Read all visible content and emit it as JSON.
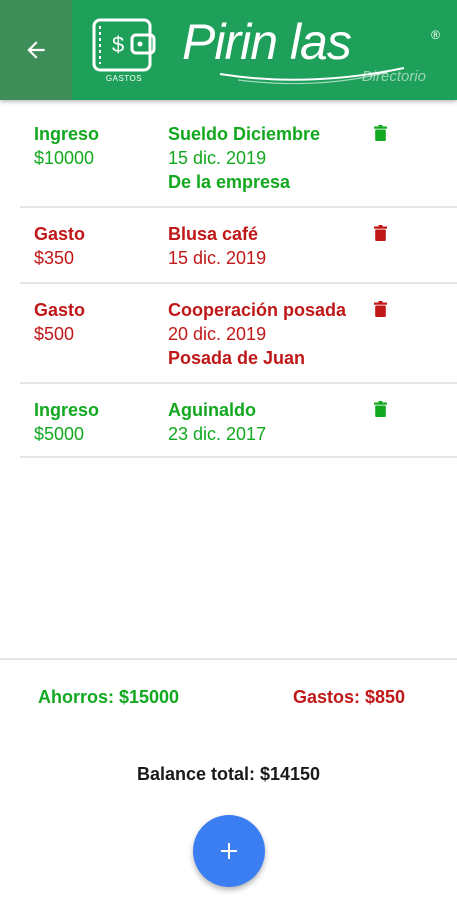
{
  "header": {
    "back_icon": "arrow-left-icon",
    "wallet_caption": "GASTOS",
    "brand": "Pirin las",
    "brand_sub": "Directorio",
    "brand_reg": "®",
    "colors": {
      "bar": "#1ea05a",
      "back_bg": "#3f8e5a"
    }
  },
  "entries": [
    {
      "type": "Ingreso",
      "amount": "$10000",
      "title": "Sueldo Diciembre",
      "date": "15 dic. 2019",
      "note": "De la empresa",
      "kind": "income"
    },
    {
      "type": "Gasto",
      "amount": "$350",
      "title": "Blusa café",
      "date": "15 dic. 2019",
      "note": "",
      "kind": "expense"
    },
    {
      "type": "Gasto",
      "amount": "$500",
      "title": "Cooperación posada",
      "date": "20 dic. 2019",
      "note": "Posada de Juan",
      "kind": "expense"
    },
    {
      "type": "Ingreso",
      "amount": "$5000",
      "title": "Aguinaldo",
      "date": "23 dic. 2017",
      "note": "",
      "kind": "income"
    }
  ],
  "summary": {
    "savings": "Ahorros: $15000",
    "expenses": "Gastos: $850",
    "balance": "Balance total: $14150"
  },
  "fab": {
    "icon": "plus-icon",
    "color": "#3b7ef2"
  },
  "colors": {
    "income": "#12a81f",
    "expense": "#c01818"
  }
}
